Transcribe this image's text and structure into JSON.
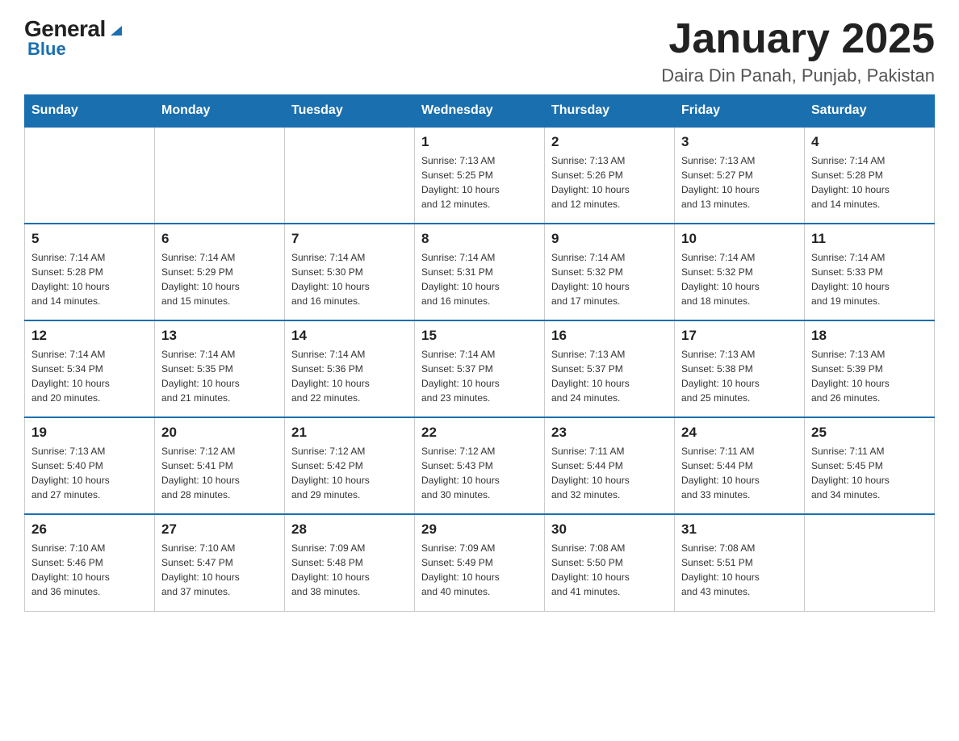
{
  "header": {
    "logo_general": "General",
    "logo_blue": "Blue",
    "title": "January 2025",
    "subtitle": "Daira Din Panah, Punjab, Pakistan"
  },
  "days_of_week": [
    "Sunday",
    "Monday",
    "Tuesday",
    "Wednesday",
    "Thursday",
    "Friday",
    "Saturday"
  ],
  "weeks": [
    [
      {
        "day": "",
        "info": ""
      },
      {
        "day": "",
        "info": ""
      },
      {
        "day": "",
        "info": ""
      },
      {
        "day": "1",
        "info": "Sunrise: 7:13 AM\nSunset: 5:25 PM\nDaylight: 10 hours\nand 12 minutes."
      },
      {
        "day": "2",
        "info": "Sunrise: 7:13 AM\nSunset: 5:26 PM\nDaylight: 10 hours\nand 12 minutes."
      },
      {
        "day": "3",
        "info": "Sunrise: 7:13 AM\nSunset: 5:27 PM\nDaylight: 10 hours\nand 13 minutes."
      },
      {
        "day": "4",
        "info": "Sunrise: 7:14 AM\nSunset: 5:28 PM\nDaylight: 10 hours\nand 14 minutes."
      }
    ],
    [
      {
        "day": "5",
        "info": "Sunrise: 7:14 AM\nSunset: 5:28 PM\nDaylight: 10 hours\nand 14 minutes."
      },
      {
        "day": "6",
        "info": "Sunrise: 7:14 AM\nSunset: 5:29 PM\nDaylight: 10 hours\nand 15 minutes."
      },
      {
        "day": "7",
        "info": "Sunrise: 7:14 AM\nSunset: 5:30 PM\nDaylight: 10 hours\nand 16 minutes."
      },
      {
        "day": "8",
        "info": "Sunrise: 7:14 AM\nSunset: 5:31 PM\nDaylight: 10 hours\nand 16 minutes."
      },
      {
        "day": "9",
        "info": "Sunrise: 7:14 AM\nSunset: 5:32 PM\nDaylight: 10 hours\nand 17 minutes."
      },
      {
        "day": "10",
        "info": "Sunrise: 7:14 AM\nSunset: 5:32 PM\nDaylight: 10 hours\nand 18 minutes."
      },
      {
        "day": "11",
        "info": "Sunrise: 7:14 AM\nSunset: 5:33 PM\nDaylight: 10 hours\nand 19 minutes."
      }
    ],
    [
      {
        "day": "12",
        "info": "Sunrise: 7:14 AM\nSunset: 5:34 PM\nDaylight: 10 hours\nand 20 minutes."
      },
      {
        "day": "13",
        "info": "Sunrise: 7:14 AM\nSunset: 5:35 PM\nDaylight: 10 hours\nand 21 minutes."
      },
      {
        "day": "14",
        "info": "Sunrise: 7:14 AM\nSunset: 5:36 PM\nDaylight: 10 hours\nand 22 minutes."
      },
      {
        "day": "15",
        "info": "Sunrise: 7:14 AM\nSunset: 5:37 PM\nDaylight: 10 hours\nand 23 minutes."
      },
      {
        "day": "16",
        "info": "Sunrise: 7:13 AM\nSunset: 5:37 PM\nDaylight: 10 hours\nand 24 minutes."
      },
      {
        "day": "17",
        "info": "Sunrise: 7:13 AM\nSunset: 5:38 PM\nDaylight: 10 hours\nand 25 minutes."
      },
      {
        "day": "18",
        "info": "Sunrise: 7:13 AM\nSunset: 5:39 PM\nDaylight: 10 hours\nand 26 minutes."
      }
    ],
    [
      {
        "day": "19",
        "info": "Sunrise: 7:13 AM\nSunset: 5:40 PM\nDaylight: 10 hours\nand 27 minutes."
      },
      {
        "day": "20",
        "info": "Sunrise: 7:12 AM\nSunset: 5:41 PM\nDaylight: 10 hours\nand 28 minutes."
      },
      {
        "day": "21",
        "info": "Sunrise: 7:12 AM\nSunset: 5:42 PM\nDaylight: 10 hours\nand 29 minutes."
      },
      {
        "day": "22",
        "info": "Sunrise: 7:12 AM\nSunset: 5:43 PM\nDaylight: 10 hours\nand 30 minutes."
      },
      {
        "day": "23",
        "info": "Sunrise: 7:11 AM\nSunset: 5:44 PM\nDaylight: 10 hours\nand 32 minutes."
      },
      {
        "day": "24",
        "info": "Sunrise: 7:11 AM\nSunset: 5:44 PM\nDaylight: 10 hours\nand 33 minutes."
      },
      {
        "day": "25",
        "info": "Sunrise: 7:11 AM\nSunset: 5:45 PM\nDaylight: 10 hours\nand 34 minutes."
      }
    ],
    [
      {
        "day": "26",
        "info": "Sunrise: 7:10 AM\nSunset: 5:46 PM\nDaylight: 10 hours\nand 36 minutes."
      },
      {
        "day": "27",
        "info": "Sunrise: 7:10 AM\nSunset: 5:47 PM\nDaylight: 10 hours\nand 37 minutes."
      },
      {
        "day": "28",
        "info": "Sunrise: 7:09 AM\nSunset: 5:48 PM\nDaylight: 10 hours\nand 38 minutes."
      },
      {
        "day": "29",
        "info": "Sunrise: 7:09 AM\nSunset: 5:49 PM\nDaylight: 10 hours\nand 40 minutes."
      },
      {
        "day": "30",
        "info": "Sunrise: 7:08 AM\nSunset: 5:50 PM\nDaylight: 10 hours\nand 41 minutes."
      },
      {
        "day": "31",
        "info": "Sunrise: 7:08 AM\nSunset: 5:51 PM\nDaylight: 10 hours\nand 43 minutes."
      },
      {
        "day": "",
        "info": ""
      }
    ]
  ]
}
